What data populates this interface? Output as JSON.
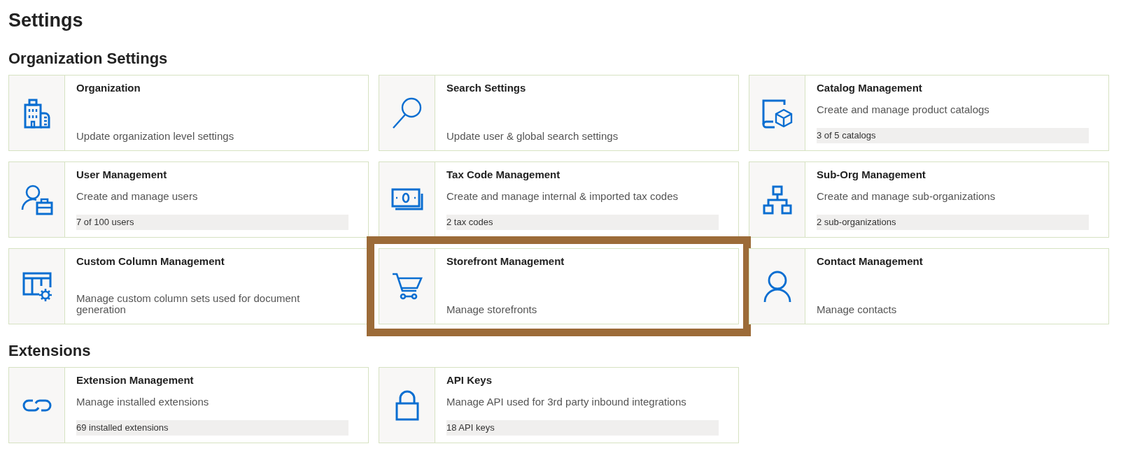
{
  "title": "Settings",
  "sections": [
    {
      "heading": "Organization Settings",
      "cards": [
        {
          "title": "Organization",
          "description": "Update organization level settings",
          "highlighted": false
        },
        {
          "title": "Search Settings",
          "description": "Update user & global search settings",
          "highlighted": false
        },
        {
          "title": "Catalog Management",
          "description": "Create and manage product catalogs",
          "count": "3 of 5 catalogs",
          "highlighted": false
        },
        {
          "title": "User Management",
          "description": "Create and manage users",
          "count": "7 of 100 users",
          "highlighted": false
        },
        {
          "title": "Tax Code Management",
          "description": "Create and manage internal & imported tax codes",
          "count": "2 tax codes",
          "highlighted": false
        },
        {
          "title": "Sub-Org Management",
          "description": "Create and manage sub-organizations",
          "count": "2 sub-organizations",
          "highlighted": false
        },
        {
          "title": "Custom Column Management",
          "description": "Manage custom column sets used for document generation",
          "highlighted": false
        },
        {
          "title": "Storefront Management",
          "description": "Manage storefronts",
          "highlighted": true
        },
        {
          "title": "Contact Management",
          "description": "Manage contacts",
          "highlighted": false
        }
      ]
    },
    {
      "heading": "Extensions",
      "cards": [
        {
          "title": "Extension Management",
          "description": "Manage installed extensions",
          "count": "69 installed extensions",
          "highlighted": false
        },
        {
          "title": "API Keys",
          "description": "Manage API used for 3rd party inbound integrations",
          "count": "18 API keys",
          "highlighted": false
        }
      ]
    }
  ]
}
